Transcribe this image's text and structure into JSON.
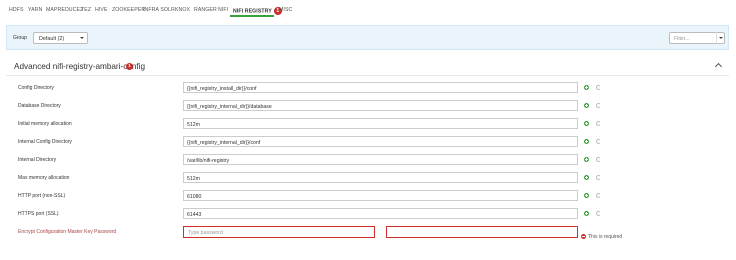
{
  "tabs": [
    {
      "label": "HDFS"
    },
    {
      "label": "YARN"
    },
    {
      "label": "MAPREDUCE2"
    },
    {
      "label": "TEZ"
    },
    {
      "label": "HIVE"
    },
    {
      "label": "ZOOKEEPER"
    },
    {
      "label": "INFRA SOLR"
    },
    {
      "label": "KNOX"
    },
    {
      "label": "RANGER"
    },
    {
      "label": "NIFI"
    },
    {
      "label": "NIFI REGISTRY",
      "badge": "1",
      "active": true
    },
    {
      "label": "MISC"
    }
  ],
  "filterbar": {
    "group_label": "Group",
    "group_value": "Default (2)",
    "filter_placeholder": "Filter..."
  },
  "section": {
    "title": "Advanced nifi-registry-ambari-config",
    "badge": "1"
  },
  "rows": [
    {
      "label": "Config Directory",
      "value": "{{nifi_registry_install_dir}}/conf"
    },
    {
      "label": "Database Directory",
      "value": "{{nifi_registry_internal_dir}}/database"
    },
    {
      "label": "Initial memory allocation",
      "value": "512m"
    },
    {
      "label": "Internal Config Directory",
      "value": "{{nifi_registry_internal_dir}}/conf"
    },
    {
      "label": "Internal Directory",
      "value": "/var/lib/nifi-registry"
    },
    {
      "label": "Max memory allocation",
      "value": "512m"
    },
    {
      "label": "HTTP port (non-SSL)",
      "value": "61080"
    },
    {
      "label": "HTTPS port (SSL)",
      "value": "61443"
    }
  ],
  "password_row": {
    "label": "Encrypt Configuration Master Key Password",
    "placeholder": "Type password",
    "confirm_value": "",
    "error": "This is required"
  },
  "colors": {
    "active_underline": "#3aa13a",
    "badge": "#c9302c",
    "filter_bar_bg": "#eaf4fb"
  }
}
